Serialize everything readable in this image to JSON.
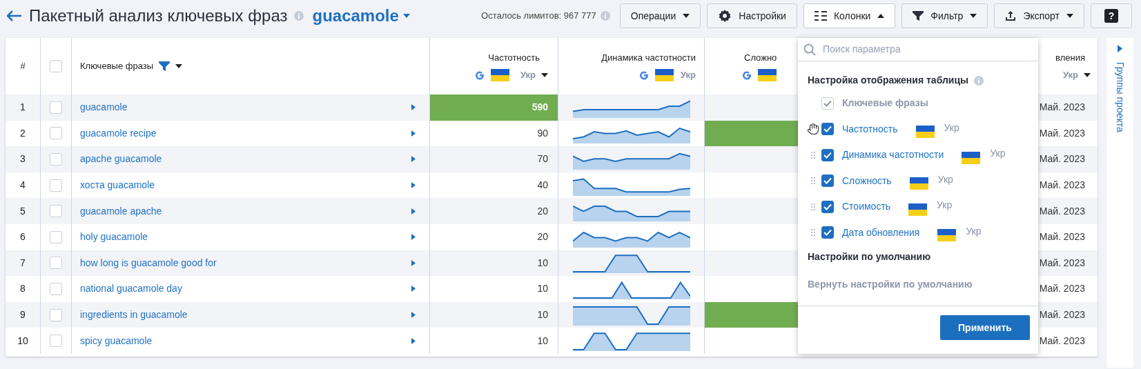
{
  "header": {
    "title": "Пакетный анализ ключевых фраз",
    "project": "guacamole",
    "limits": "Осталось лимитов: 967 777"
  },
  "toolbar": [
    {
      "label": "Операции",
      "kind": "menu",
      "expanded": false
    },
    {
      "label": "Настройки",
      "kind": "settings"
    },
    {
      "label": "Колонки",
      "kind": "columns",
      "expanded": true
    },
    {
      "label": "Фильтр",
      "kind": "filter",
      "expanded": false
    },
    {
      "label": "Экспорт",
      "kind": "export",
      "expanded": false
    },
    {
      "label": "?",
      "kind": "help"
    }
  ],
  "table": {
    "headers": {
      "number": "#",
      "all_checked": false,
      "phrase": "Ключевые фразы",
      "frequency": {
        "label": "Частотность",
        "region": "Укр"
      },
      "dynamics": {
        "label": "Динамика частотности",
        "region": "Укр"
      },
      "difficulty": {
        "label": "Сложно"
      },
      "date": {
        "label": "вления",
        "region": "Укр"
      }
    },
    "rows": [
      {
        "number": "1",
        "checked": false,
        "phrase": "guacamole",
        "frequency": "590",
        "frequency_highlighted": true,
        "difficulty_highlighted": false,
        "date": "Май. 2023"
      },
      {
        "number": "2",
        "checked": false,
        "phrase": "guacamole recipe",
        "frequency": "90",
        "frequency_highlighted": false,
        "difficulty_highlighted": true,
        "date": "Май. 2023"
      },
      {
        "number": "3",
        "checked": false,
        "phrase": "apache guacamole",
        "frequency": "70",
        "frequency_highlighted": false,
        "difficulty_highlighted": false,
        "date": "Май. 2023"
      },
      {
        "number": "4",
        "checked": false,
        "phrase": "хоста guacamole",
        "frequency": "40",
        "frequency_highlighted": false,
        "difficulty_highlighted": false,
        "date": "Май. 2023"
      },
      {
        "number": "5",
        "checked": false,
        "phrase": "guacamole apache",
        "frequency": "20",
        "frequency_highlighted": false,
        "difficulty_highlighted": false,
        "date": "Май. 2023"
      },
      {
        "number": "6",
        "checked": false,
        "phrase": "holy guacamole",
        "frequency": "20",
        "frequency_highlighted": false,
        "difficulty_highlighted": false,
        "date": "Май. 2023"
      },
      {
        "number": "7",
        "checked": false,
        "phrase": "how long is guacamole good for",
        "frequency": "10",
        "frequency_highlighted": false,
        "difficulty_highlighted": false,
        "date": "Май. 2023"
      },
      {
        "number": "8",
        "checked": false,
        "phrase": "national guacamole day",
        "frequency": "10",
        "frequency_highlighted": false,
        "difficulty_highlighted": false,
        "date": "Май. 2023"
      },
      {
        "number": "9",
        "checked": false,
        "phrase": "ingredients in guacamole",
        "frequency": "10",
        "frequency_highlighted": false,
        "difficulty_highlighted": true,
        "date": "Май. 2023"
      },
      {
        "number": "10",
        "checked": false,
        "phrase": "spicy guacamole",
        "frequency": "10",
        "frequency_highlighted": false,
        "difficulty_highlighted": false,
        "date": "Май. 2023"
      }
    ]
  },
  "columns_panel": {
    "search_placeholder": "Поиск параметра",
    "title": "Настройка отображения таблицы",
    "items": [
      {
        "label": "Ключевые фразы",
        "checked": true,
        "disabled": true,
        "hovered": false
      },
      {
        "label": "Частотность",
        "checked": true,
        "disabled": false,
        "hovered": true,
        "region": "Укр"
      },
      {
        "label": "Динамика частотности",
        "checked": true,
        "disabled": false,
        "hovered": false,
        "region": "Укр"
      },
      {
        "label": "Сложность",
        "checked": true,
        "disabled": false,
        "hovered": false,
        "region": "Укр"
      },
      {
        "label": "Стоимость",
        "checked": true,
        "disabled": false,
        "hovered": false,
        "region": "Укр"
      },
      {
        "label": "Дата обновления",
        "checked": true,
        "disabled": false,
        "hovered": false,
        "region": "Укр"
      }
    ],
    "defaults_title": "Настройки по умолчанию",
    "reset": {
      "label": "Вернуть настройки по умолчанию",
      "disabled": true
    },
    "apply": "Применить"
  },
  "sidebar": {
    "label": "Группы проекта"
  }
}
